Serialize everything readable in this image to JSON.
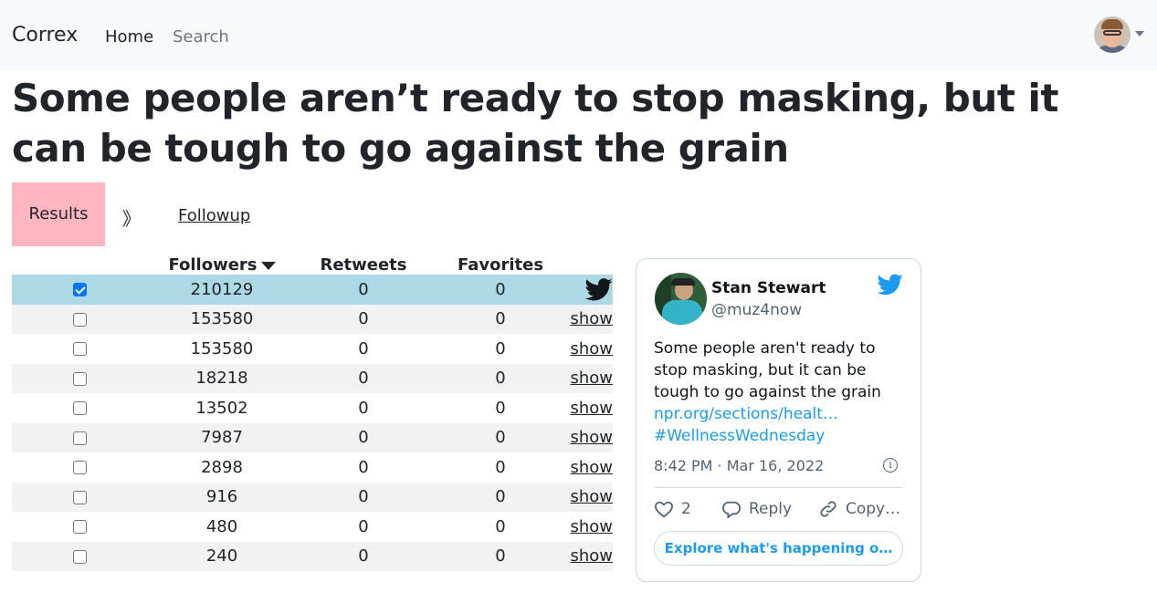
{
  "navbar": {
    "brand": "Correx",
    "home": "Home",
    "search": "Search"
  },
  "headline": "Some people aren’t ready to stop masking, but it can be tough to go against the grain",
  "steps": {
    "results": "Results",
    "separator": "》",
    "followup": "Followup"
  },
  "table": {
    "headers": {
      "followers": "Followers",
      "retweets": "Retweets",
      "favorites": "Favorites"
    },
    "rows": [
      {
        "checked": true,
        "followers": "210129",
        "retweets": "0",
        "favorites": "0",
        "action": ""
      },
      {
        "checked": false,
        "followers": "153580",
        "retweets": "0",
        "favorites": "0",
        "action": "show"
      },
      {
        "checked": false,
        "followers": "153580",
        "retweets": "0",
        "favorites": "0",
        "action": "show"
      },
      {
        "checked": false,
        "followers": "18218",
        "retweets": "0",
        "favorites": "0",
        "action": "show"
      },
      {
        "checked": false,
        "followers": "13502",
        "retweets": "0",
        "favorites": "0",
        "action": "show"
      },
      {
        "checked": false,
        "followers": "7987",
        "retweets": "0",
        "favorites": "0",
        "action": "show"
      },
      {
        "checked": false,
        "followers": "2898",
        "retweets": "0",
        "favorites": "0",
        "action": "show"
      },
      {
        "checked": false,
        "followers": "916",
        "retweets": "0",
        "favorites": "0",
        "action": "show"
      },
      {
        "checked": false,
        "followers": "480",
        "retweets": "0",
        "favorites": "0",
        "action": "show"
      },
      {
        "checked": false,
        "followers": "240",
        "retweets": "0",
        "favorites": "0",
        "action": "show"
      }
    ]
  },
  "tweet": {
    "name": "Stan Stewart",
    "handle": "@muz4now",
    "text": "Some people aren't ready to stop masking, but it can be tough to go against the grain ",
    "link": "npr.org/sections/healt…",
    "hashtag": "#WellnessWednesday",
    "time": "8:42 PM · Mar 16, 2022",
    "likes": "2",
    "reply": "Reply",
    "copy": "Copy…",
    "explore": "Explore what's happening o…"
  },
  "colors": {
    "navbar_bg": "#f8f9fa",
    "results_bg": "#ffb6c1",
    "selected_row": "#add8e6",
    "striped_row": "#f2f2f2",
    "twitter_blue": "#1d9bf0"
  }
}
